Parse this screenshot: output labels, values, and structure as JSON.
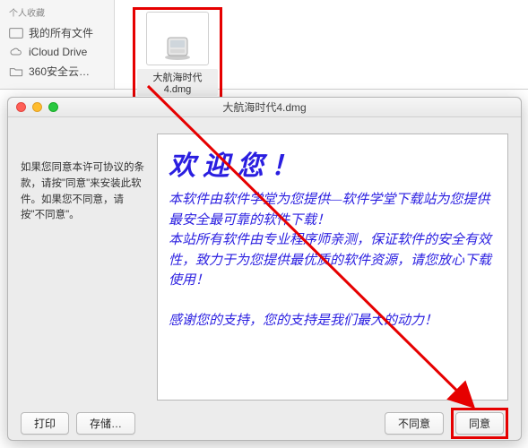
{
  "finder": {
    "sidebar_header": "个人收藏",
    "items": [
      {
        "label": "我的所有文件"
      },
      {
        "label": "iCloud Drive"
      },
      {
        "label": "360安全云…"
      }
    ],
    "file_label": "大航海时代4.dmg"
  },
  "dialog": {
    "title": "大航海时代4.dmg",
    "notice": "如果您同意本许可协议的条款，请按\"同意\"来安装此软件。如果您不同意，请按\"不同意\"。",
    "welcome_heading": "欢迎您！",
    "welcome_body": "本软件由软件学堂为您提供—软件学堂下载站为您提供最安全最可靠的软件下载！\n本站所有软件由专业程序师亲测，保证软件的安全有效性，致力于为您提供最优质的软件资源，请您放心下载使用！\n\n感谢您的支持，您的支持是我们最大的动力！",
    "buttons": {
      "print": "打印",
      "save": "存储…",
      "disagree": "不同意",
      "agree": "同意"
    }
  }
}
